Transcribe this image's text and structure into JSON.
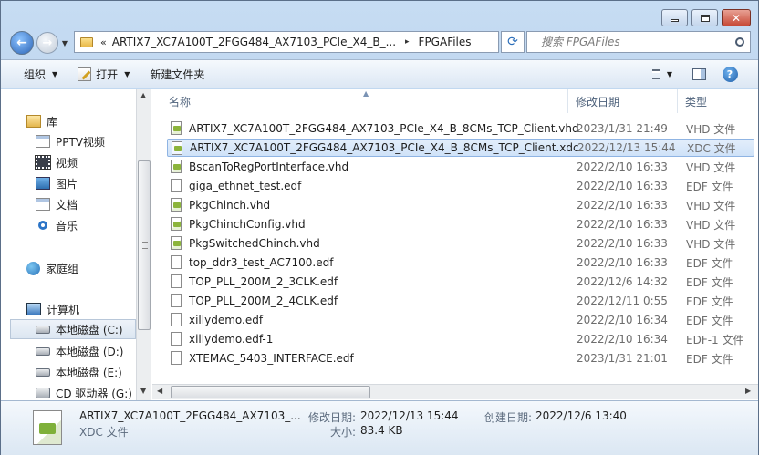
{
  "window": {
    "minimize_icon": "minimize-icon",
    "maximize_icon": "maximize-icon",
    "close_icon": "close-icon"
  },
  "address_bar": {
    "chevron": "«",
    "path": [
      "ARTIX7_XC7A100T_2FGG484_AX7103_PCIe_X4_B_...",
      "FPGAFiles"
    ],
    "separator": "▸"
  },
  "search": {
    "placeholder": "搜索 FPGAFiles"
  },
  "toolbar": {
    "organize": "组织",
    "open": "打开",
    "new_folder": "新建文件夹"
  },
  "nav": {
    "libraries": "库",
    "pptv": "PPTV视频",
    "videos": "视频",
    "pictures": "图片",
    "documents": "文档",
    "music": "音乐",
    "homegroup": "家庭组",
    "computer": "计算机",
    "drive_c": "本地磁盘 (C:)",
    "drive_d": "本地磁盘 (D:)",
    "drive_e": "本地磁盘 (E:)",
    "drive_g": "CD 驱动器 (G:)"
  },
  "columns": {
    "name": "名称",
    "date": "修改日期",
    "type": "类型"
  },
  "files": [
    {
      "name": "ARTIX7_XC7A100T_2FGG484_AX7103_PCIe_X4_B_8CMs_TCP_Client.vhd",
      "date": "2023/1/31 21:49",
      "type": "VHD 文件",
      "icon": "vhd"
    },
    {
      "name": "ARTIX7_XC7A100T_2FGG484_AX7103_PCIe_X4_B_8CMs_TCP_Client.xdc",
      "date": "2022/12/13 15:44",
      "type": "XDC 文件",
      "icon": "xdc"
    },
    {
      "name": "BscanToRegPortInterface.vhd",
      "date": "2022/2/10 16:33",
      "type": "VHD 文件",
      "icon": "vhd"
    },
    {
      "name": "giga_ethnet_test.edf",
      "date": "2022/2/10 16:33",
      "type": "EDF 文件",
      "icon": "edf"
    },
    {
      "name": "PkgChinch.vhd",
      "date": "2022/2/10 16:33",
      "type": "VHD 文件",
      "icon": "vhd"
    },
    {
      "name": "PkgChinchConfig.vhd",
      "date": "2022/2/10 16:33",
      "type": "VHD 文件",
      "icon": "vhd"
    },
    {
      "name": "PkgSwitchedChinch.vhd",
      "date": "2022/2/10 16:33",
      "type": "VHD 文件",
      "icon": "vhd"
    },
    {
      "name": "top_ddr3_test_AC7100.edf",
      "date": "2022/2/10 16:33",
      "type": "EDF 文件",
      "icon": "edf"
    },
    {
      "name": "TOP_PLL_200M_2_3CLK.edf",
      "date": "2022/12/6 14:32",
      "type": "EDF 文件",
      "icon": "edf"
    },
    {
      "name": "TOP_PLL_200M_2_4CLK.edf",
      "date": "2022/12/11 0:55",
      "type": "EDF 文件",
      "icon": "edf"
    },
    {
      "name": "xillydemo.edf",
      "date": "2022/2/10 16:34",
      "type": "EDF 文件",
      "icon": "edf"
    },
    {
      "name": "xillydemo.edf-1",
      "date": "2022/2/10 16:34",
      "type": "EDF-1 文件",
      "icon": "edf"
    },
    {
      "name": "XTEMAC_5403_INTERFACE.edf",
      "date": "2023/1/31 21:01",
      "type": "EDF 文件",
      "icon": "edf"
    }
  ],
  "details": {
    "name": "ARTIX7_XC7A100T_2FGG484_AX7103_...",
    "type": "XDC 文件",
    "modified_label": "修改日期:",
    "modified": "2022/12/13 15:44",
    "created_label": "创建日期:",
    "created": "2022/12/6 13:40",
    "size_label": "大小:",
    "size": "83.4 KB"
  }
}
